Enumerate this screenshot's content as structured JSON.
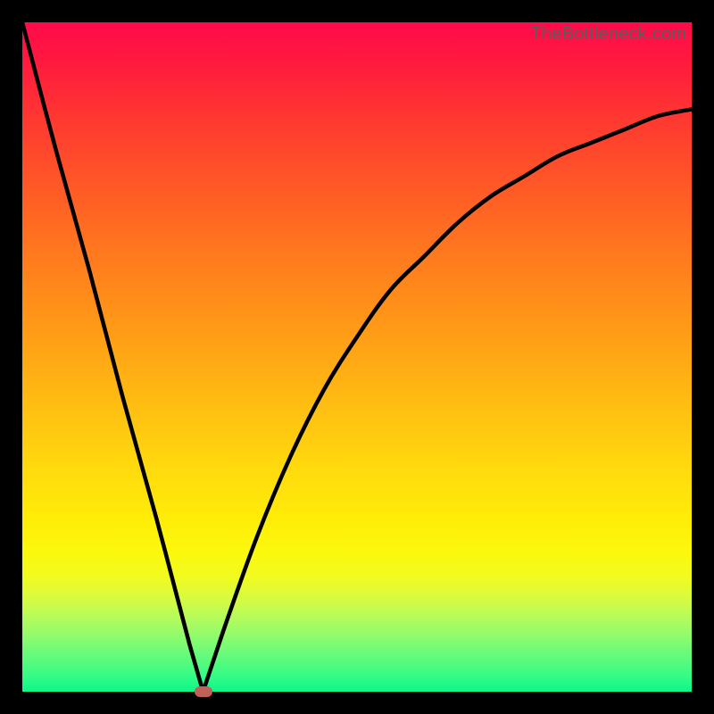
{
  "watermark": "TheBottleneck.com",
  "colors": {
    "frame_bg": "#000000",
    "curve_stroke": "#000000",
    "marker_fill": "#c06058"
  },
  "chart_data": {
    "type": "line",
    "title": "",
    "xlabel": "",
    "ylabel": "",
    "xlim": [
      0,
      100
    ],
    "ylim": [
      0,
      100
    ],
    "grid": false,
    "legend": false,
    "series": [
      {
        "name": "left-branch",
        "x": [
          0,
          5,
          10,
          15,
          20,
          25,
          27
        ],
        "values": [
          100,
          81,
          63,
          44,
          26,
          7,
          0
        ]
      },
      {
        "name": "right-branch",
        "x": [
          27,
          30,
          35,
          40,
          45,
          50,
          55,
          60,
          65,
          70,
          75,
          80,
          85,
          90,
          95,
          100
        ],
        "values": [
          0,
          9,
          23,
          35,
          45,
          53,
          60,
          65,
          70,
          74,
          77,
          80,
          82,
          84,
          86,
          87
        ]
      }
    ],
    "marker": {
      "x": 27,
      "y": 0
    },
    "gradient_colors_top_to_bottom": [
      "#ff0a4a",
      "#ffec08",
      "#0cf78a"
    ]
  }
}
